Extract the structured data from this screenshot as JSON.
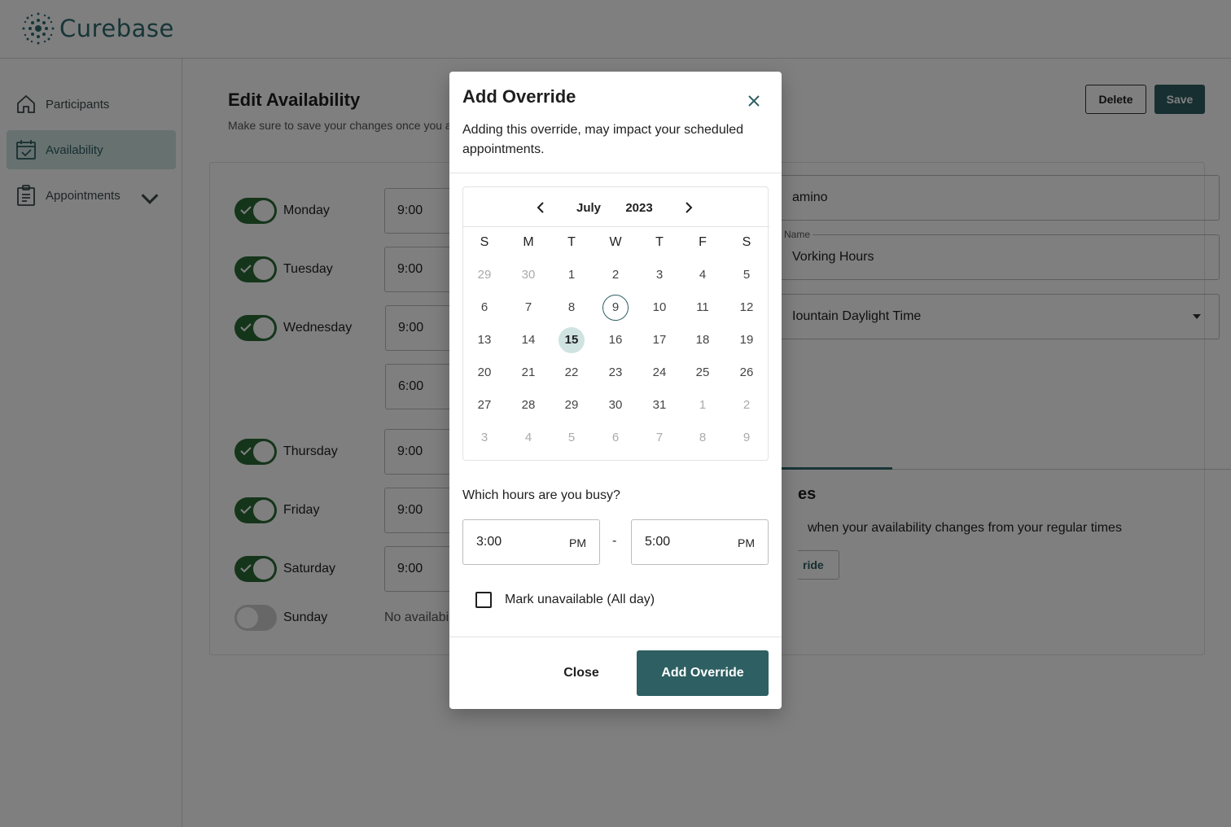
{
  "app": {
    "name": "Curebase"
  },
  "sidebar": {
    "items": [
      {
        "label": "Participants",
        "icon": "home-icon"
      },
      {
        "label": "Availability",
        "icon": "calendar-check-icon",
        "active": true
      },
      {
        "label": "Appointments",
        "icon": "clipboard-icon"
      }
    ]
  },
  "page": {
    "title": "Edit Availability",
    "subtitle": "Make sure to save your changes once you a",
    "delete_label": "Delete",
    "save_label": "Save"
  },
  "schedule": {
    "days": [
      {
        "name": "Monday",
        "enabled": true,
        "time": "9:00"
      },
      {
        "name": "Tuesday",
        "enabled": true,
        "time": "9:00"
      },
      {
        "name": "Wednesday",
        "enabled": true,
        "time": "9:00",
        "extra_time": "6:00"
      },
      {
        "name": "Thursday",
        "enabled": true,
        "time": "9:00"
      },
      {
        "name": "Friday",
        "enabled": true,
        "time": "9:00"
      },
      {
        "name": "Saturday",
        "enabled": true,
        "time": "9:00"
      },
      {
        "name": "Sunday",
        "enabled": false,
        "no_availability": "No availabili"
      }
    ]
  },
  "right_panel": {
    "site_value": "amino",
    "name_label": "Name",
    "name_value": "Vorking Hours",
    "timezone_value": "Iountain Daylight Time",
    "overrides_title": "es",
    "overrides_sub": "when your availability changes from your regular times",
    "overrides_button": "ride"
  },
  "modal": {
    "title": "Add Override",
    "description": "Adding this override, may impact your scheduled appointments.",
    "calendar": {
      "month": "July",
      "year": "2023",
      "weekdays": [
        "S",
        "M",
        "T",
        "W",
        "T",
        "F",
        "S"
      ],
      "weeks": [
        [
          "29",
          "30",
          "1",
          "2",
          "3",
          "4",
          "5"
        ],
        [
          "6",
          "7",
          "8",
          "9",
          "10",
          "11",
          "12"
        ],
        [
          "13",
          "14",
          "15",
          "16",
          "17",
          "18",
          "19"
        ],
        [
          "20",
          "21",
          "22",
          "23",
          "24",
          "25",
          "26"
        ],
        [
          "27",
          "28",
          "29",
          "30",
          "31",
          "1",
          "2"
        ],
        [
          "3",
          "4",
          "5",
          "6",
          "7",
          "8",
          "9"
        ]
      ],
      "today": "9",
      "selected": "15"
    },
    "busy_question": "Which hours are you busy?",
    "start_time": "3:00",
    "start_meridiem": "PM",
    "separator": "-",
    "end_time": "5:00",
    "end_meridiem": "PM",
    "mark_unavailable_label": "Mark unavailable (All day)",
    "mark_unavailable_checked": false,
    "close_label": "Close",
    "submit_label": "Add Override"
  },
  "colors": {
    "brand": "#2e6b6e",
    "primary_button": "#2e5f62",
    "toggle_on": "#2b6b36",
    "nav_active_bg": "#cfe3e1"
  }
}
